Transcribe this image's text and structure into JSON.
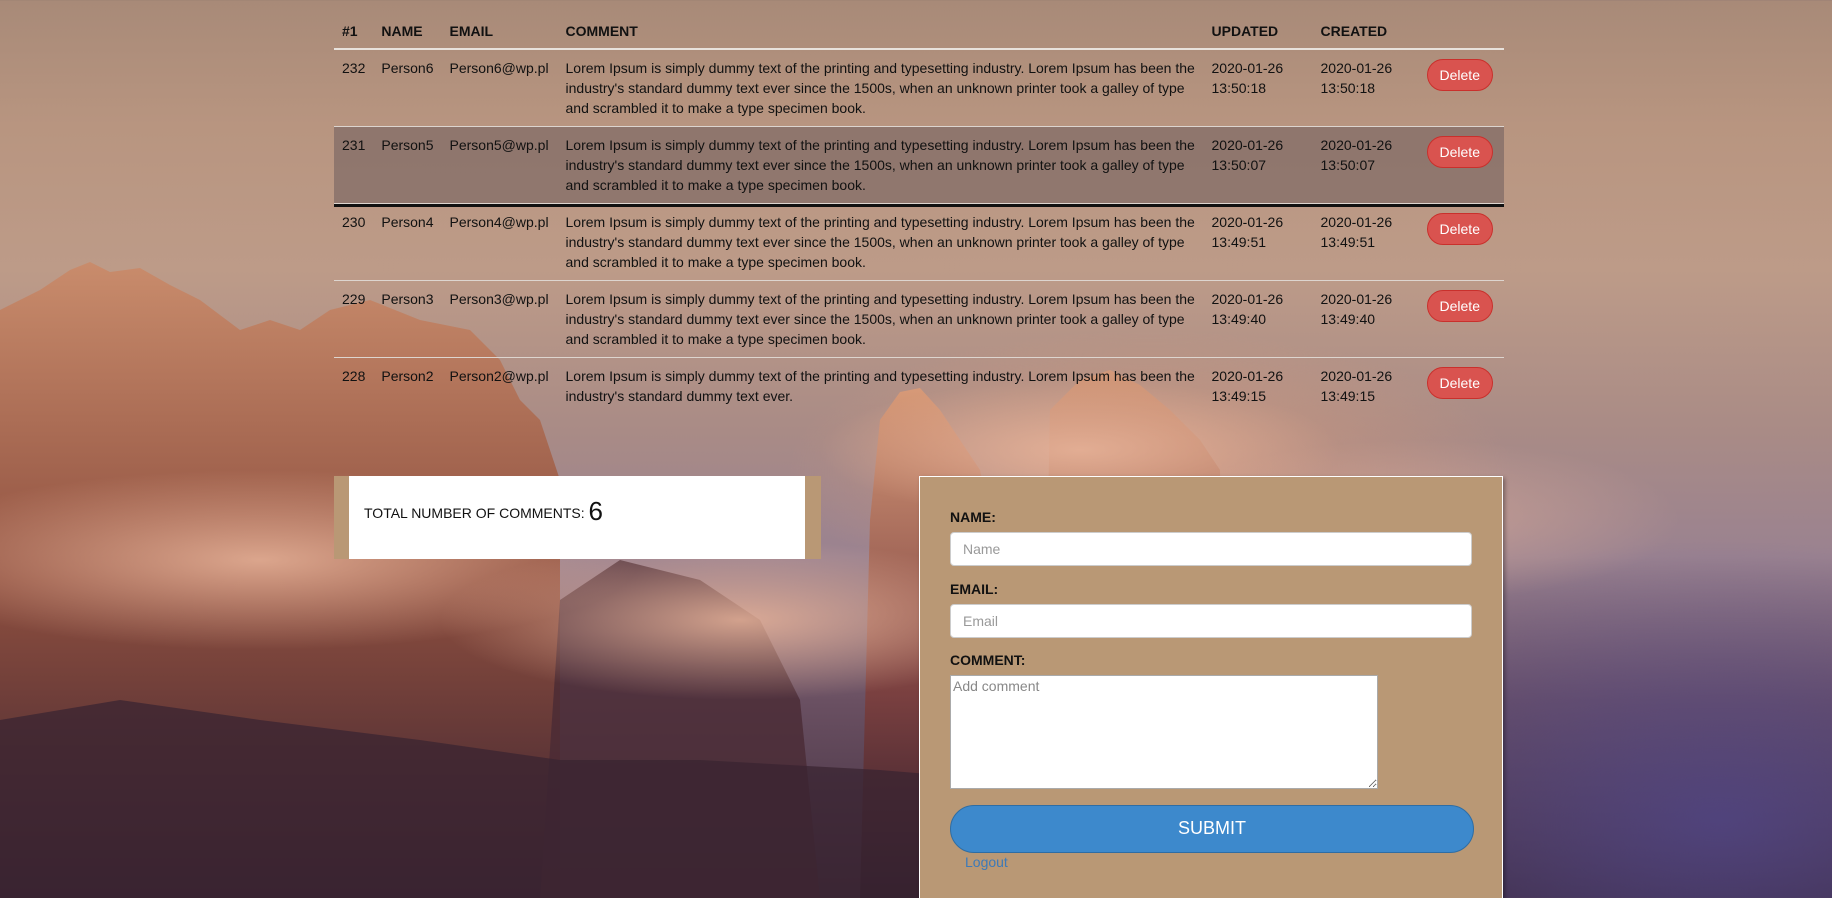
{
  "table": {
    "headers": {
      "id": "#1",
      "name": "NAME",
      "email": "EMAIL",
      "comment": "COMMENT",
      "updated": "UPDATED",
      "created": "CREATED"
    },
    "delete_label": "Delete",
    "rows": [
      {
        "id": "232",
        "name": "Person6",
        "email": "Person6@wp.pl",
        "comment": "Lorem Ipsum is simply dummy text of the printing and typesetting industry. Lorem Ipsum has been the industry's standard dummy text ever since the 1500s, when an unknown printer took a galley of type and scrambled it to make a type specimen book.",
        "updated_date": "2020-01-26",
        "updated_time": "13:50:18",
        "created_date": "2020-01-26",
        "created_time": "13:50:18"
      },
      {
        "id": "231",
        "name": "Person5",
        "email": "Person5@wp.pl",
        "comment": "Lorem Ipsum is simply dummy text of the printing and typesetting industry. Lorem Ipsum has been the industry's standard dummy text ever since the 1500s, when an unknown printer took a galley of type and scrambled it to make a type specimen book.",
        "updated_date": "2020-01-26",
        "updated_time": "13:50:07",
        "created_date": "2020-01-26",
        "created_time": "13:50:07"
      },
      {
        "id": "230",
        "name": "Person4",
        "email": "Person4@wp.pl",
        "comment": "Lorem Ipsum is simply dummy text of the printing and typesetting industry. Lorem Ipsum has been the industry's standard dummy text ever since the 1500s, when an unknown printer took a galley of type and scrambled it to make a type specimen book.",
        "updated_date": "2020-01-26",
        "updated_time": "13:49:51",
        "created_date": "2020-01-26",
        "created_time": "13:49:51"
      },
      {
        "id": "229",
        "name": "Person3",
        "email": "Person3@wp.pl",
        "comment": "Lorem Ipsum is simply dummy text of the printing and typesetting industry. Lorem Ipsum has been the industry's standard dummy text ever since the 1500s, when an unknown printer took a galley of type and scrambled it to make a type specimen book.",
        "updated_date": "2020-01-26",
        "updated_time": "13:49:40",
        "created_date": "2020-01-26",
        "created_time": "13:49:40"
      },
      {
        "id": "228",
        "name": "Person2",
        "email": "Person2@wp.pl",
        "comment": "Lorem Ipsum is simply dummy text of the printing and typesetting industry. Lorem Ipsum has been the industry's standard dummy text ever.",
        "updated_date": "2020-01-26",
        "updated_time": "13:49:15",
        "created_date": "2020-01-26",
        "created_time": "13:49:15"
      }
    ]
  },
  "stats": {
    "total_label": "TOTAL NUMBER OF COMMENTS:",
    "total_count": "6"
  },
  "form": {
    "name_label": "NAME:",
    "name_placeholder": "Name",
    "email_label": "EMAIL:",
    "email_placeholder": "Email",
    "comment_label": "COMMENT:",
    "comment_placeholder": "Add comment",
    "submit_label": "SUBMIT",
    "logout_label": "Logout"
  },
  "colors": {
    "delete_button": "#d9534f",
    "submit_button": "#3d89cc",
    "form_panel": "#b99875",
    "link": "#3d7ab8"
  }
}
